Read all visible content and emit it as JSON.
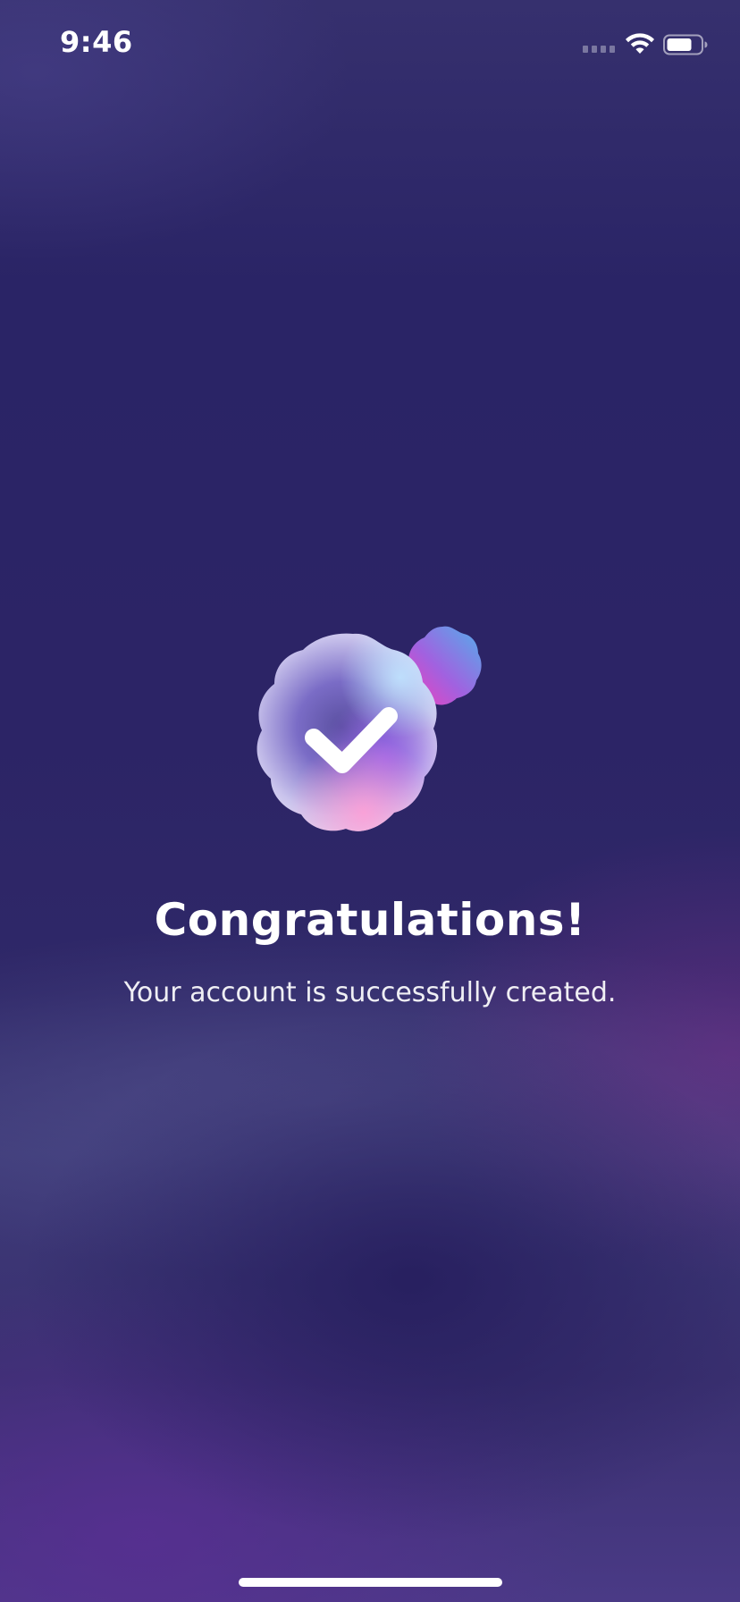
{
  "status_bar": {
    "time": "9:46",
    "icons": [
      "cellular-signal-icon",
      "wifi-icon",
      "battery-icon"
    ]
  },
  "illustration": {
    "main_icon": "checkmark-badge-icon",
    "accent_icon": "small-badge-icon",
    "accent_colors": [
      "#e24bd0",
      "#5aa6ee",
      "#8b5fe0"
    ]
  },
  "content": {
    "title": "Congratulations!",
    "subtitle": "Your account is successfully created."
  },
  "colors": {
    "background_top": "#36306e",
    "background_mid": "#2c2466",
    "background_bottom": "#4a3a86",
    "text": "#ffffff"
  }
}
